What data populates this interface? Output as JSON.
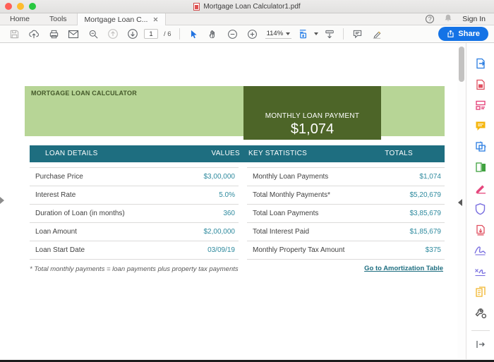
{
  "window": {
    "title": "Mortgage Loan Calculator1.pdf"
  },
  "tabs": {
    "home": "Home",
    "tools": "Tools",
    "document_tab": "Mortgage Loan C...",
    "sign_in": "Sign In"
  },
  "icons": {
    "help_glyph": "?"
  },
  "toolbar": {
    "page_current": "1",
    "page_total": "/ 6",
    "zoom_level": "114%",
    "share_label": "Share"
  },
  "sidebar_tools": [
    "export-pdf",
    "create-pdf",
    "edit-pdf",
    "comment",
    "combine-files",
    "organize-pages",
    "fill-sign",
    "protect",
    "compress-pdf",
    "request-signatures",
    "prepare-form",
    "stamp",
    "more-tools"
  ],
  "document": {
    "banner": {
      "title": "MORTGAGE LOAN CALCULATOR",
      "payment_label": "MONTHLY LOAN PAYMENT",
      "payment_value": "$1,074"
    },
    "loan_details": {
      "header": [
        "LOAN DETAILS",
        "VALUES"
      ],
      "rows": [
        [
          "Purchase Price",
          "$3,00,000"
        ],
        [
          "Interest Rate",
          "5.0%"
        ],
        [
          "Duration of Loan (in months)",
          "360"
        ],
        [
          "Loan Amount",
          "$2,00,000"
        ],
        [
          "Loan Start Date",
          "03/09/19"
        ]
      ]
    },
    "key_statistics": {
      "header": [
        "KEY STATISTICS",
        "TOTALS"
      ],
      "rows": [
        [
          "Monthly Loan Payments",
          "$1,074"
        ],
        [
          "Total Monthly Payments*",
          "$5,20,679"
        ],
        [
          "Total Loan Payments",
          "$3,85,679"
        ],
        [
          "Total Interest Paid",
          "$1,85,679"
        ],
        [
          "Monthly Property Tax Amount",
          "$375"
        ]
      ]
    },
    "footnote": "* Total monthly payments = loan payments plus property tax payments",
    "amortization_link": "Go to Amortization Table"
  },
  "colors": {
    "banner_light_green": "#b7d596",
    "banner_dark_green": "#4d6528",
    "table_header_teal": "#1e6e80",
    "value_text_teal": "#2e8a9e",
    "link_teal": "#1e6e80",
    "share_button_blue": "#1473e6",
    "selection_blue": "#2273e0"
  }
}
